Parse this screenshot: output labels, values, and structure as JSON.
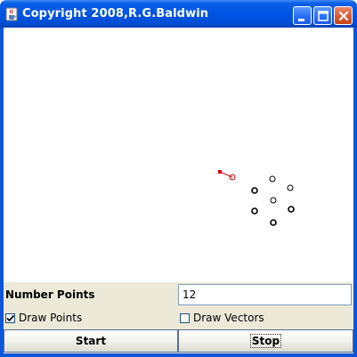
{
  "window": {
    "title": "Copyright 2008,R.G.Baldwin",
    "icons": [
      "java-cup-icon",
      "minimize-icon",
      "maximize-icon",
      "close-icon"
    ]
  },
  "canvas": {
    "points_shown": 8,
    "point_color": "#000000",
    "highlight_color": "#cc0000"
  },
  "controls": {
    "number_points_label": "Number Points",
    "number_points_value": "12",
    "draw_points_label": "Draw Points",
    "draw_points_checked": true,
    "draw_vectors_label": "Draw Vectors",
    "draw_vectors_checked": false,
    "start_label": "Start",
    "stop_label": "Stop"
  }
}
